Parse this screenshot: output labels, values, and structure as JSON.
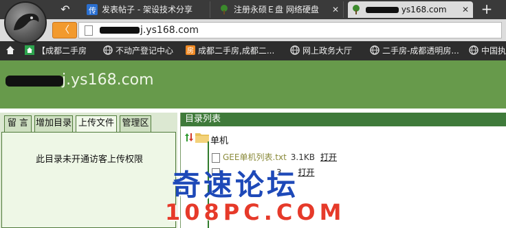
{
  "browser": {
    "back_glyph": "↶",
    "tabs": [
      {
        "label": "发表帖子 - 架设技术分享",
        "icon": "chuan-app-icon",
        "close": "✕"
      },
      {
        "label": "注册永硕Ｅ盘   网络硬盘",
        "icon": "tree-icon",
        "close": "✕"
      },
      {
        "label": "ys168.com",
        "icon": "tree-icon",
        "close": "✕"
      }
    ],
    "new_tab_glyph": "+",
    "address": {
      "back_glyph": "〈",
      "url_visible": "j.ys168.com"
    },
    "bookmarks": [
      {
        "label": "【成都二手房",
        "icon": "green-home-icon"
      },
      {
        "label": "不动产登记中心",
        "icon": "globe-icon"
      },
      {
        "label": "成都二手房,成都二...",
        "icon": "orange-fang-icon"
      },
      {
        "label": "网上政务大厅",
        "icon": "globe-icon"
      },
      {
        "label": "二手房-成都透明房...",
        "icon": "globe-icon"
      },
      {
        "label": "中国执",
        "icon": "globe-icon"
      }
    ]
  },
  "page": {
    "site_title": "j.ys168.com",
    "left_tabs": [
      "留 言",
      "增加目录",
      "上传文件",
      "管理区"
    ],
    "active_left_tab": "上传文件",
    "left_message": "此目录未开通访客上传权限",
    "right_header": "目录列表",
    "folder": {
      "name": "单机"
    },
    "files": [
      {
        "name": "GEE单机列表.txt",
        "size": "3.1KB",
        "action": "打开"
      },
      {
        "name": "",
        "size": "3.",
        "action": "打开"
      }
    ]
  },
  "watermark": {
    "line1": "奇速论坛",
    "line2": "108PC.COM"
  },
  "colors": {
    "banner_green": "#679a4b",
    "header_green": "#3f7a3a",
    "panel_green": "#dce8d2",
    "back_orange": "#f29a2e",
    "watermark_blue": "#1e49b8",
    "watermark_red": "#e63a2a"
  }
}
